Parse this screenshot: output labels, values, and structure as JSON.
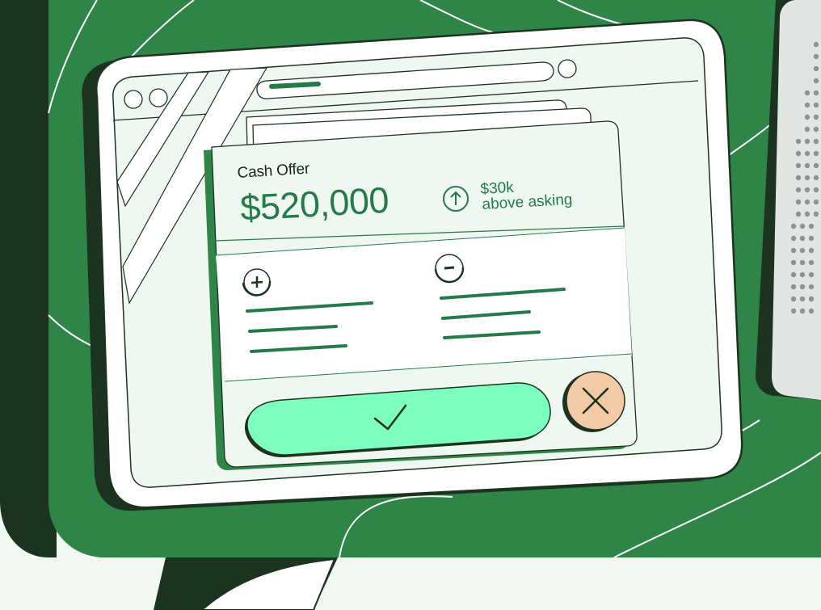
{
  "offer_card": {
    "title": "Cash Offer",
    "amount": "$520,000",
    "delta_amount": "$30k",
    "delta_label": "above asking"
  },
  "colors": {
    "dark_green": "#1c3320",
    "monitor_green": "#2f8447",
    "screen_bg": "#eef8f0",
    "accept_button": "#7dffbd",
    "reject_button": "#f3caa6",
    "accent_text": "#257a4a"
  },
  "icons": {
    "accept": "checkmark-icon",
    "reject": "close-icon",
    "increase": "arrow-up-icon",
    "pros": "plus-icon",
    "cons": "minus-icon"
  }
}
